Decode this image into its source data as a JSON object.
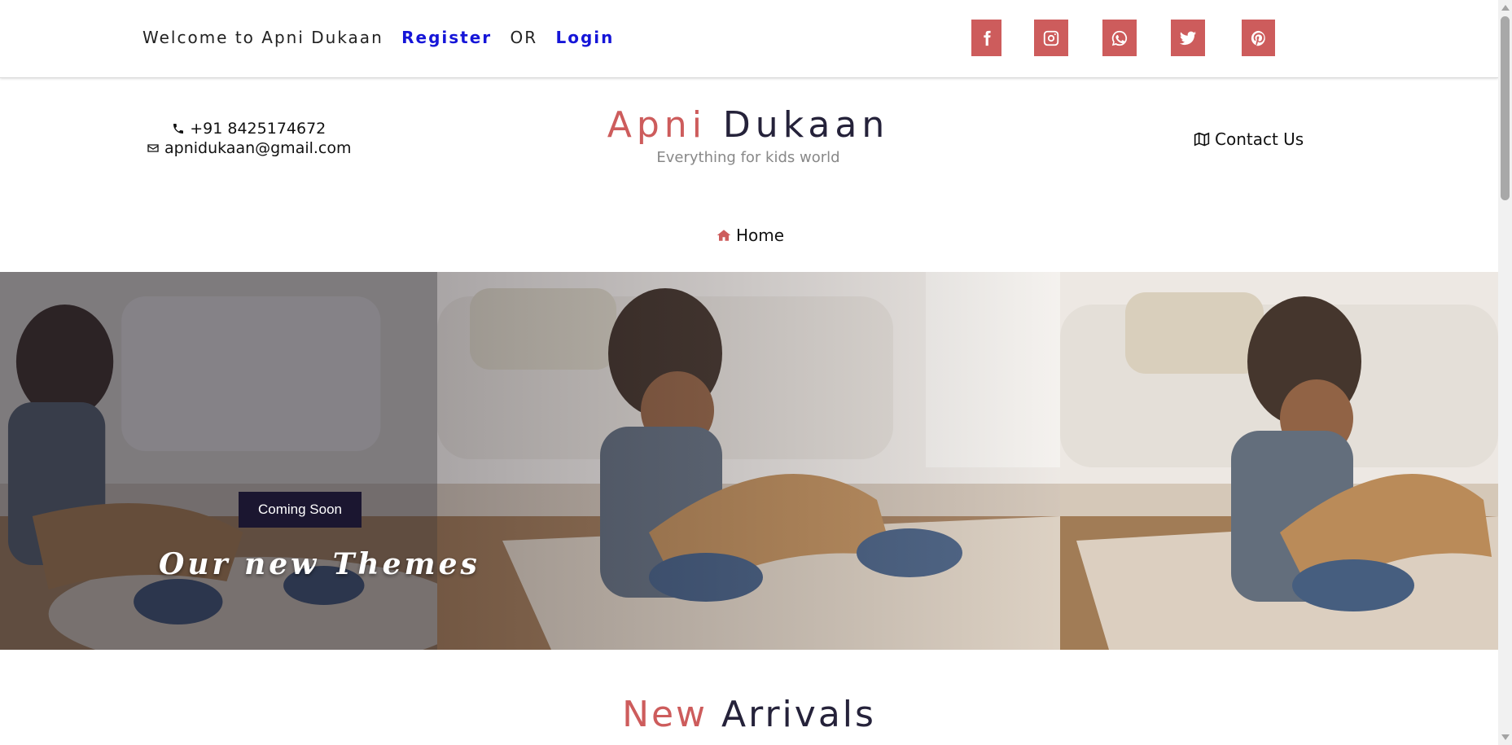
{
  "topbar": {
    "welcome_text": "Welcome to Apni Dukaan",
    "register_label": "Register",
    "or_text": "OR",
    "login_label": "Login",
    "social": [
      {
        "icon": "facebook-icon"
      },
      {
        "icon": "instagram-icon"
      },
      {
        "icon": "whatsapp-icon"
      },
      {
        "icon": "twitter-icon"
      },
      {
        "icon": "pinterest-icon"
      }
    ]
  },
  "header": {
    "phone": "+91 8425174672",
    "email": "apnidukaan@gmail.com",
    "brand_first": "Apni",
    "brand_second": "Dukaan",
    "tagline": "Everything for kids world",
    "contact_label": "Contact Us"
  },
  "nav": {
    "home_label": "Home"
  },
  "hero": {
    "badge_label": "Coming Soon",
    "title": "Our new Themes"
  },
  "section": {
    "title_first": "New",
    "title_second": "Arrivals"
  },
  "colors": {
    "accent": "#cd5c5c",
    "dark": "#25223a",
    "link": "#1515d8"
  }
}
